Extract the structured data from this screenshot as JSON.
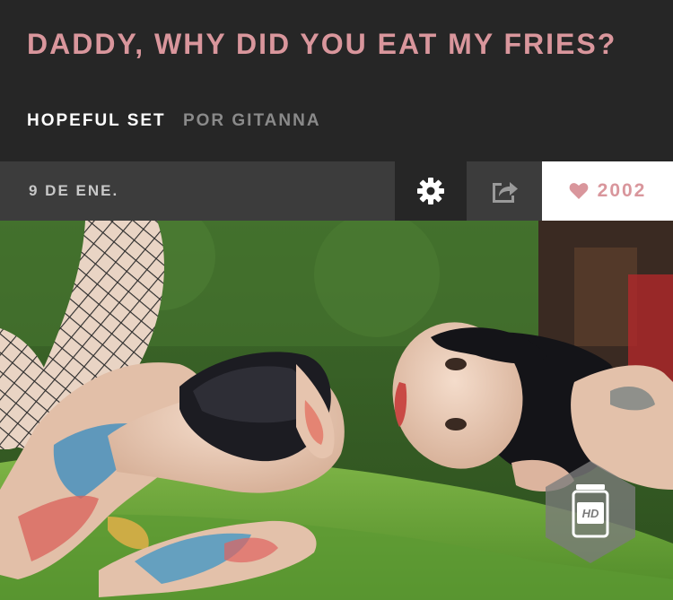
{
  "post": {
    "title": "DADDY, WHY DID YOU EAT MY FRIES?",
    "set_name": "HOPEFUL SET",
    "by_line": "POR GITANNA"
  },
  "toolbar": {
    "date": "9 DE ENE.",
    "likes": "2002"
  },
  "photo": {
    "hd_label": "HD"
  },
  "colors": {
    "accent_pink": "#d9969c",
    "header_bg": "#262626",
    "toolbar_gray": "#3c3c3c"
  },
  "icons": [
    "gear-icon",
    "share-icon",
    "heart-icon",
    "hd-icon"
  ]
}
